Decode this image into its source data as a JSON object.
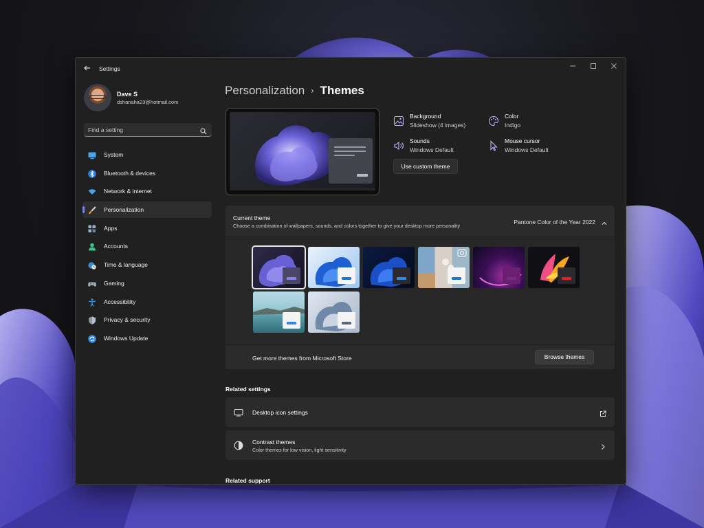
{
  "window": {
    "app_title": "Settings",
    "controls": [
      "minimize",
      "maximize",
      "close"
    ]
  },
  "profile": {
    "name": "Dave S",
    "email": "dshanaha23@hotmail.com"
  },
  "search": {
    "placeholder": "Find a setting"
  },
  "sidebar": {
    "items": [
      {
        "label": "System",
        "icon": "monitor-icon",
        "active": false
      },
      {
        "label": "Bluetooth & devices",
        "icon": "bluetooth-icon",
        "active": false
      },
      {
        "label": "Network & internet",
        "icon": "wifi-icon",
        "active": false
      },
      {
        "label": "Personalization",
        "icon": "brush-icon",
        "active": true
      },
      {
        "label": "Apps",
        "icon": "apps-icon",
        "active": false
      },
      {
        "label": "Accounts",
        "icon": "person-icon",
        "active": false
      },
      {
        "label": "Time & language",
        "icon": "globe-clock-icon",
        "active": false
      },
      {
        "label": "Gaming",
        "icon": "gamepad-icon",
        "active": false
      },
      {
        "label": "Accessibility",
        "icon": "accessibility-icon",
        "active": false
      },
      {
        "label": "Privacy & security",
        "icon": "shield-icon",
        "active": false
      },
      {
        "label": "Windows Update",
        "icon": "update-icon",
        "active": false
      }
    ]
  },
  "breadcrumb": {
    "parent": "Personalization",
    "separator": "›",
    "current": "Themes"
  },
  "theme_props": {
    "background": {
      "title": "Background",
      "value": "Slideshow (4 images)"
    },
    "color": {
      "title": "Color",
      "value": "Indigo"
    },
    "sounds": {
      "title": "Sounds",
      "value": "Windows Default"
    },
    "cursor": {
      "title": "Mouse cursor",
      "value": "Windows Default"
    },
    "custom_button": "Use custom theme"
  },
  "current_theme": {
    "title": "Current theme",
    "subtitle": "Choose a combination of wallpapers, sounds, and colors together to give your desktop more personality",
    "value": "Pantone Color of the Year 2022",
    "themes": [
      {
        "name": "indigo-bloom",
        "selected": true
      },
      {
        "name": "windows-light",
        "selected": false
      },
      {
        "name": "windows-dark",
        "selected": false
      },
      {
        "name": "captured-motion",
        "selected": false
      },
      {
        "name": "glow",
        "selected": false
      },
      {
        "name": "flow",
        "selected": false
      },
      {
        "name": "sunrise-lake",
        "selected": false
      },
      {
        "name": "bloom-light",
        "selected": false
      }
    ],
    "store_text": "Get more themes from Microsoft Store",
    "browse_button": "Browse themes"
  },
  "related_settings": {
    "title": "Related settings",
    "desktop_icons": {
      "title": "Desktop icon settings"
    },
    "contrast": {
      "title": "Contrast themes",
      "subtitle": "Color themes for low vision, light sensitivity"
    }
  },
  "related_support": {
    "title": "Related support"
  },
  "colors": {
    "accent": "#7a86e8",
    "window_bg": "#202020",
    "card_bg": "#2b2b2b"
  }
}
